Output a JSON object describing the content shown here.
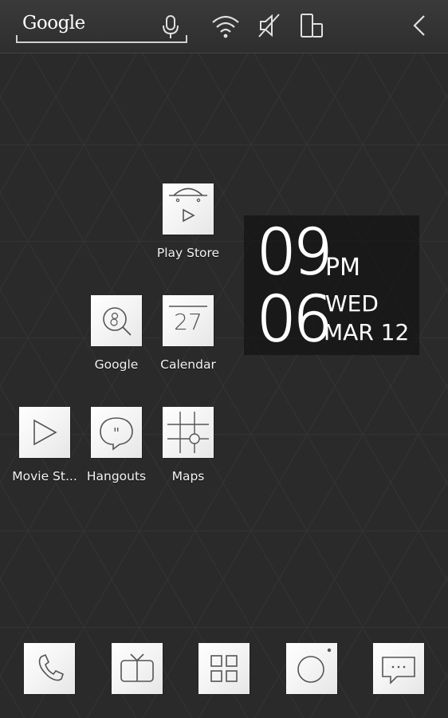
{
  "statusbar": {
    "search_label": "Google",
    "icons": [
      "mic-icon",
      "wifi-icon",
      "sound-muted-icon",
      "screen-rotate-icon",
      "back-chevron-icon"
    ]
  },
  "apps": {
    "play_store": "Play Store",
    "google": "Google",
    "calendar": "Calendar",
    "calendar_day": "27",
    "movie_studio": "Movie St...",
    "hangouts": "Hangouts",
    "maps": "Maps"
  },
  "clock": {
    "hour": "09",
    "ampm": "PM",
    "minute": "06",
    "weekday": "WED",
    "date": "MAR 12"
  },
  "dock": {
    "icons": [
      "phone-icon",
      "tv-icon",
      "app-drawer-icon",
      "camera-icon",
      "messaging-icon"
    ]
  },
  "colors": {
    "background": "#2a2a2a",
    "tile": "#f4f4f4",
    "icon_stroke": "#555555"
  }
}
